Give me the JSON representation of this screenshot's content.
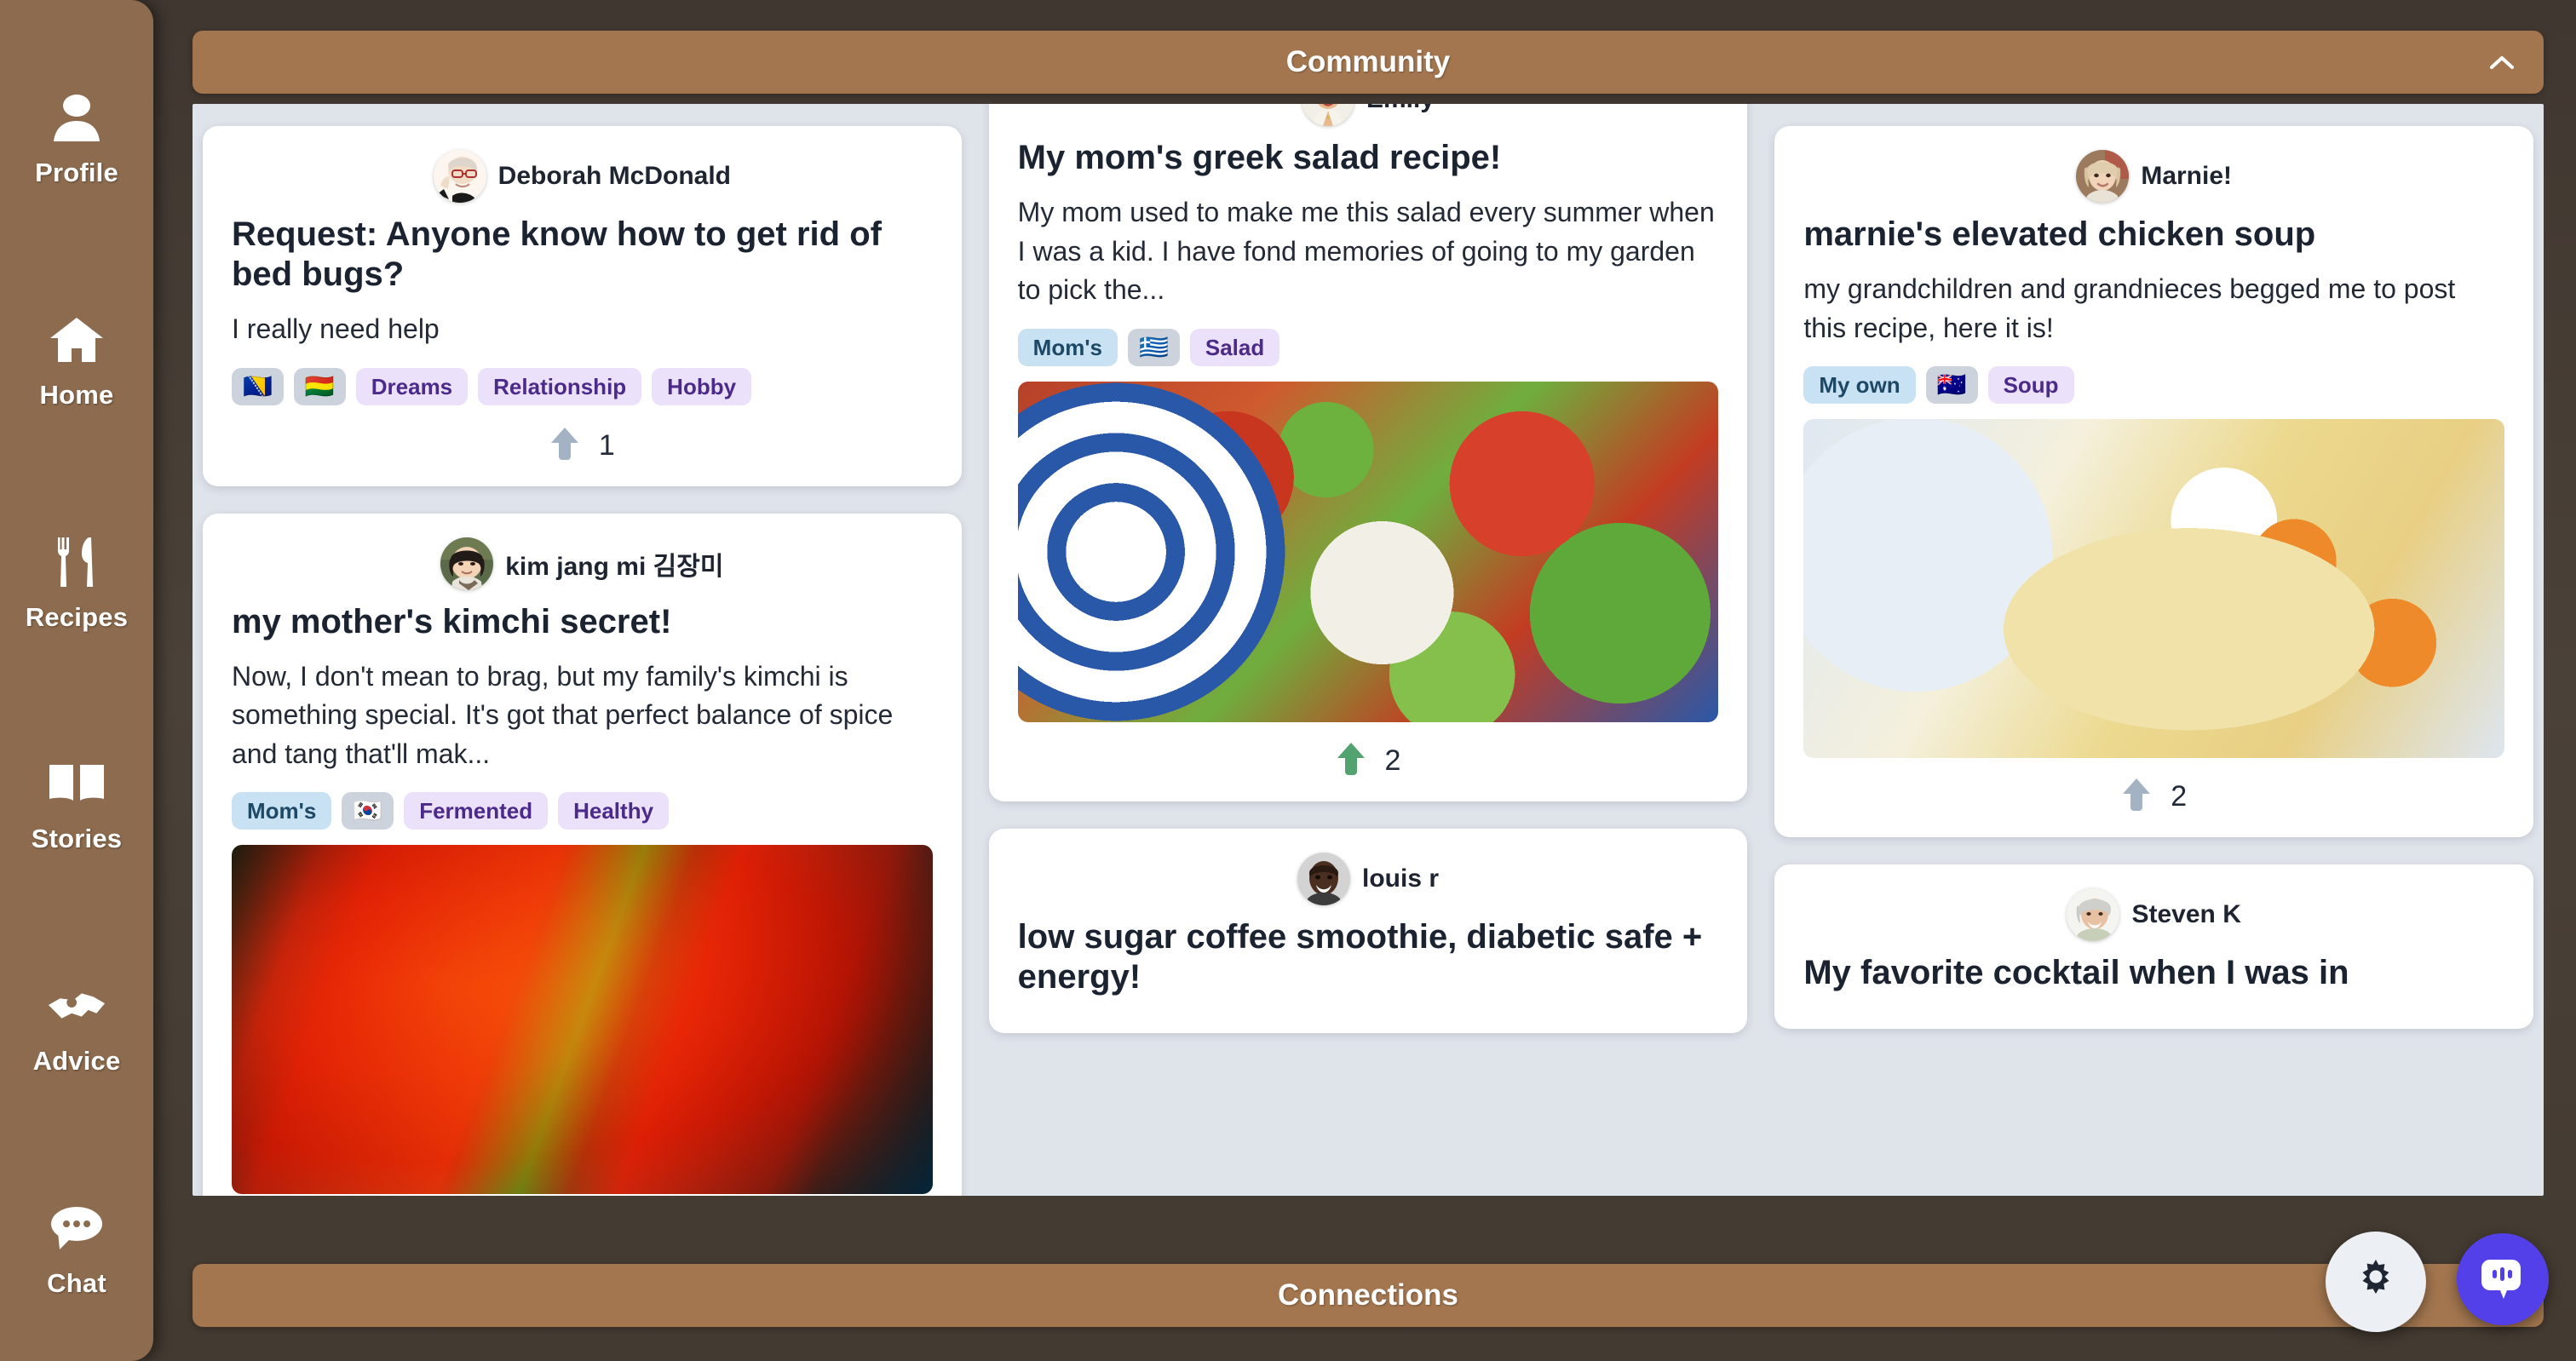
{
  "sidebar": {
    "items": [
      {
        "label": "Profile",
        "icon": "person-icon"
      },
      {
        "label": "Home",
        "icon": "house-icon"
      },
      {
        "label": "Recipes",
        "icon": "fork-knife-icon"
      },
      {
        "label": "Stories",
        "icon": "open-book-icon"
      },
      {
        "label": "Advice",
        "icon": "handshake-icon"
      },
      {
        "label": "Chat",
        "icon": "chat-bubble-icon"
      }
    ]
  },
  "header": {
    "title": "Community",
    "collapse_icon": "chevron-up-icon"
  },
  "footer": {
    "title": "Connections"
  },
  "fabs": {
    "settings": {
      "name": "settings-button",
      "icon": "gear-icon"
    },
    "assistant": {
      "name": "assistant-chat-button",
      "icon": "chat-bubble-icon"
    }
  },
  "colors": {
    "brand_brown": "#8d6b4e",
    "band_brown": "#a3764f",
    "page_bg": "#4a4138",
    "feed_bg": "#dfe3ea",
    "card_bg": "#ffffff",
    "tag_purple_bg": "#ece1fb",
    "tag_purple_text": "#4b2a8a",
    "tag_blue_bg": "#c8e2f4",
    "tag_blue_text": "#1d4866",
    "tag_flag_bg": "#ccd3dd",
    "upvote_active": "#52a36f",
    "upvote_inactive": "#a3b3c4",
    "accent_purple": "#5340e8"
  },
  "columns": [
    {
      "posts": [
        {
          "author": "Deborah McDonald",
          "avatar": "avatar-deborah",
          "title": "Request: Anyone know how to get rid of bed bugs?",
          "body": "I really need help",
          "tags": [
            {
              "label": "🇧🇦",
              "style": "flag"
            },
            {
              "label": "🇧🇴",
              "style": "flag"
            },
            {
              "label": "Dreams",
              "style": "purple"
            },
            {
              "label": "Relationship",
              "style": "purple"
            },
            {
              "label": "Hobby",
              "style": "purple"
            }
          ],
          "photo": null,
          "votes": "1",
          "vote_state": "inactive"
        },
        {
          "author": "kim jang mi 김장미",
          "avatar": "avatar-kim",
          "title": "my mother's kimchi secret!",
          "body": "Now, I don't mean to brag, but my family's kimchi is something special. It's got that perfect balance of spice and tang that'll mak...",
          "tags": [
            {
              "label": "Mom's",
              "style": "blue"
            },
            {
              "label": "🇰🇷",
              "style": "flag"
            },
            {
              "label": "Fermented",
              "style": "purple"
            },
            {
              "label": "Healthy",
              "style": "purple"
            }
          ],
          "photo": "kimchi-photo",
          "votes": null,
          "vote_state": null
        }
      ]
    },
    {
      "posts": [
        {
          "author": "Emily",
          "avatar": "avatar-emily",
          "title": "My mom's greek salad recipe!",
          "body": "My mom used to make me this salad every summer when I was a kid. I have fond memories of going to my garden to pick the...",
          "tags": [
            {
              "label": "Mom's",
              "style": "blue"
            },
            {
              "label": "🇬🇷",
              "style": "flag"
            },
            {
              "label": "Salad",
              "style": "purple"
            }
          ],
          "photo": "greek-salad-photo",
          "votes": "2",
          "vote_state": "active"
        },
        {
          "author": "louis r",
          "avatar": "avatar-louis",
          "title": "low sugar coffee smoothie, diabetic safe + energy!",
          "body": null,
          "tags": [],
          "photo": null,
          "votes": null,
          "vote_state": null
        }
      ]
    },
    {
      "posts": [
        {
          "author": "Marnie!",
          "avatar": "avatar-marnie",
          "title": "marnie's elevated chicken soup",
          "body": "my grandchildren and grandnieces begged me to post this recipe, here it is!",
          "tags": [
            {
              "label": "My own",
              "style": "blue"
            },
            {
              "label": "🇦🇺",
              "style": "flag"
            },
            {
              "label": "Soup",
              "style": "purple"
            }
          ],
          "photo": "chicken-soup-photo",
          "votes": "2",
          "vote_state": "inactive"
        },
        {
          "author": "Steven K",
          "avatar": "avatar-steven",
          "title": "My favorite cocktail when I was in",
          "body": null,
          "tags": [],
          "photo": null,
          "votes": null,
          "vote_state": null
        }
      ]
    }
  ]
}
